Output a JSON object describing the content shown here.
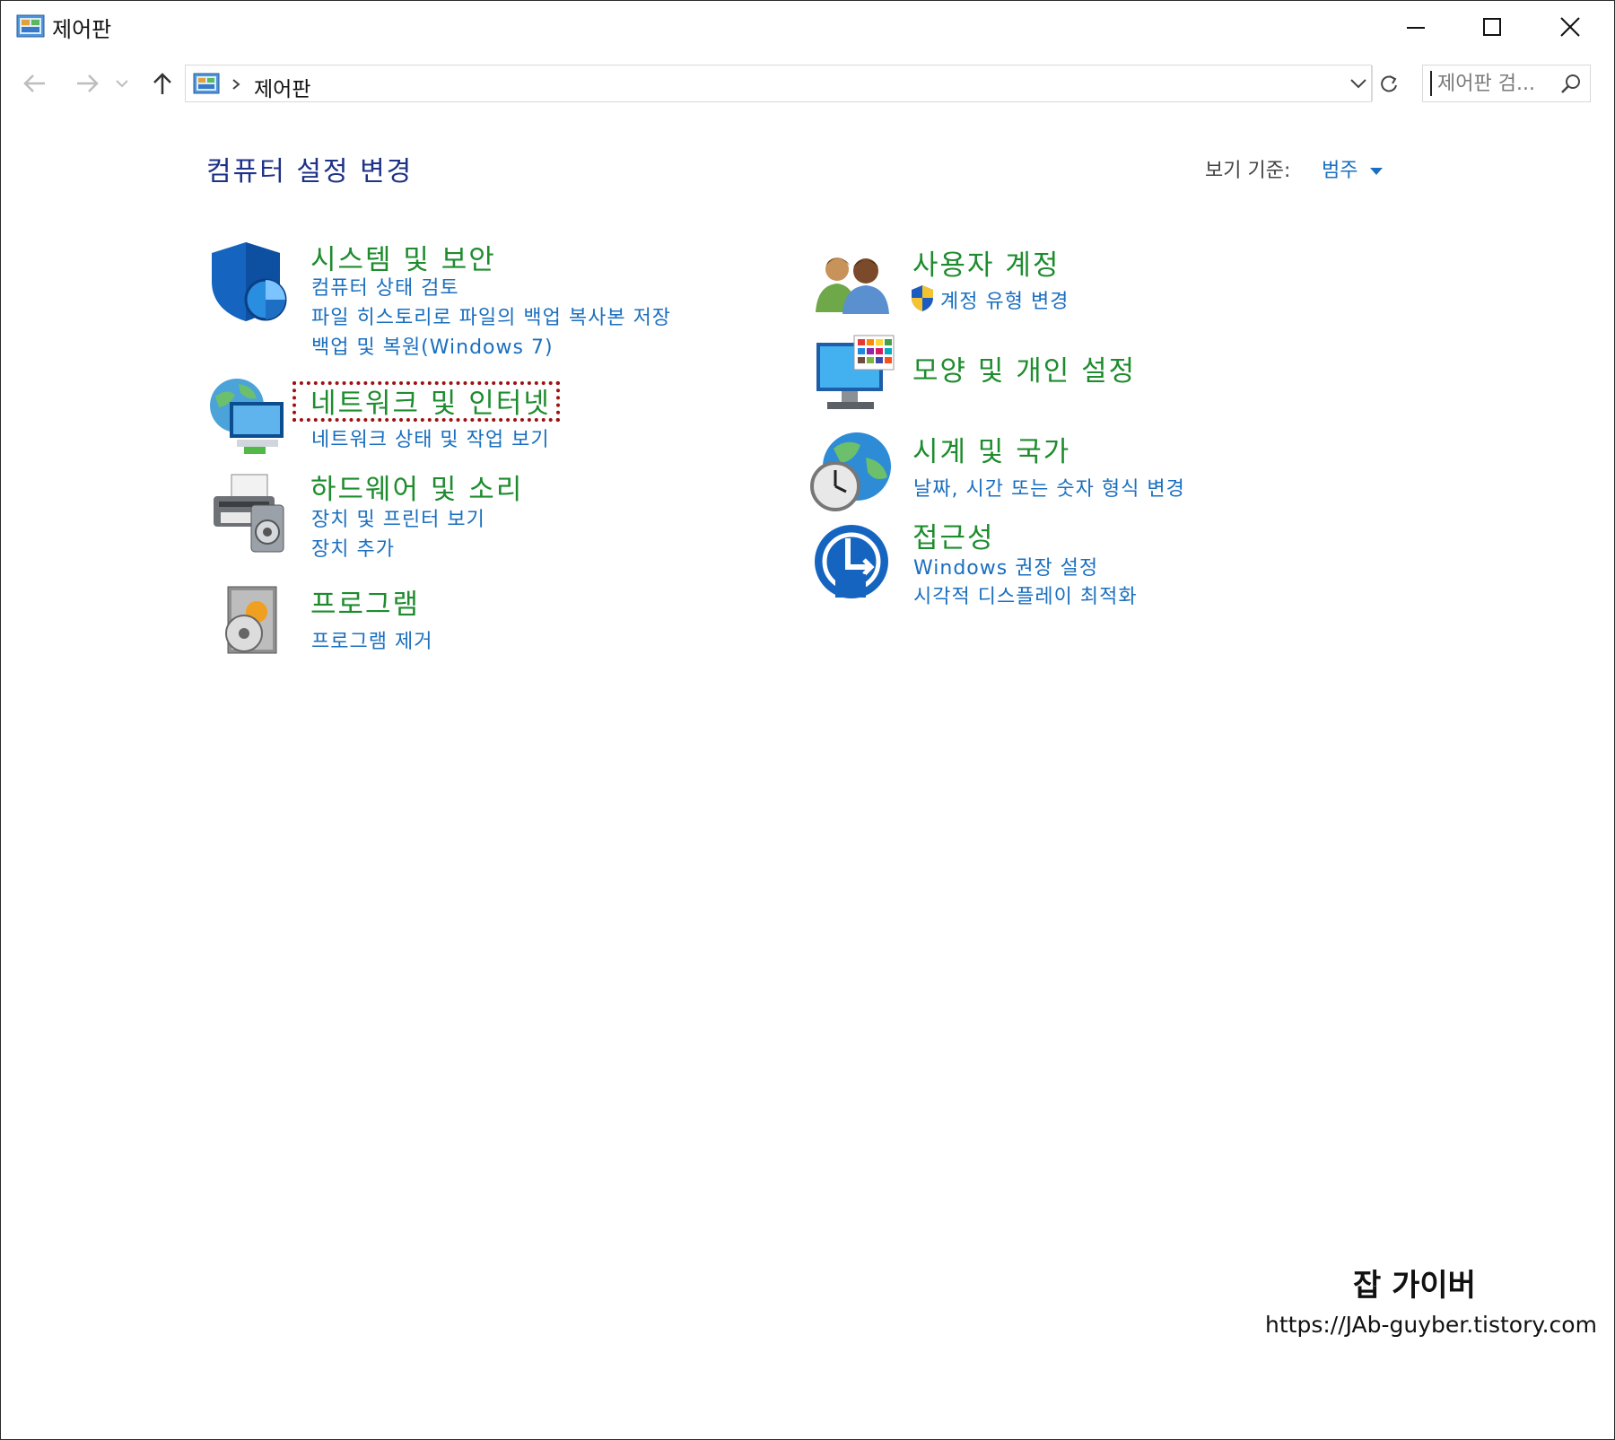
{
  "window": {
    "title": "제어판"
  },
  "address": {
    "path": "제어판"
  },
  "search": {
    "placeholder": "제어판 검..."
  },
  "main": {
    "heading": "컴퓨터 설정 변경",
    "view_by_label": "보기 기준:",
    "view_by_value": "범주"
  },
  "categories_left": [
    {
      "title": "시스템 및 보안",
      "icon": "security-shield-icon",
      "links": [
        "컴퓨터 상태 검토",
        "파일 히스토리로 파일의 백업 복사본 저장",
        "백업 및 복원(Windows 7)"
      ]
    },
    {
      "title": "네트워크 및 인터넷",
      "icon": "network-globe-icon",
      "links": [
        "네트워크 상태 및 작업 보기"
      ]
    },
    {
      "title": "하드웨어 및 소리",
      "icon": "printer-speaker-icon",
      "links": [
        "장치 및 프린터 보기",
        "장치 추가"
      ]
    },
    {
      "title": "프로그램",
      "icon": "programs-box-icon",
      "links": [
        "프로그램 제거"
      ]
    }
  ],
  "categories_right": [
    {
      "title": "사용자 계정",
      "icon": "users-icon",
      "links": [
        "계정 유형 변경"
      ]
    },
    {
      "title": "모양 및 개인 설정",
      "icon": "monitor-palette-icon",
      "links": []
    },
    {
      "title": "시계 및 국가",
      "icon": "clock-globe-icon",
      "links": [
        "날짜, 시간 또는 숫자 형식 변경"
      ]
    },
    {
      "title": "접근성",
      "icon": "ease-of-access-icon",
      "links": [
        "Windows 권장 설정",
        "시각적 디스플레이 최적화"
      ]
    }
  ],
  "watermark": {
    "name": "잡 가이버",
    "url": "https://JAb-guyber.tistory.com"
  },
  "colors": {
    "category_title": "#1e8c2e",
    "link": "#1a6fbf",
    "heading": "#1e3287",
    "highlight": "#a01010"
  }
}
